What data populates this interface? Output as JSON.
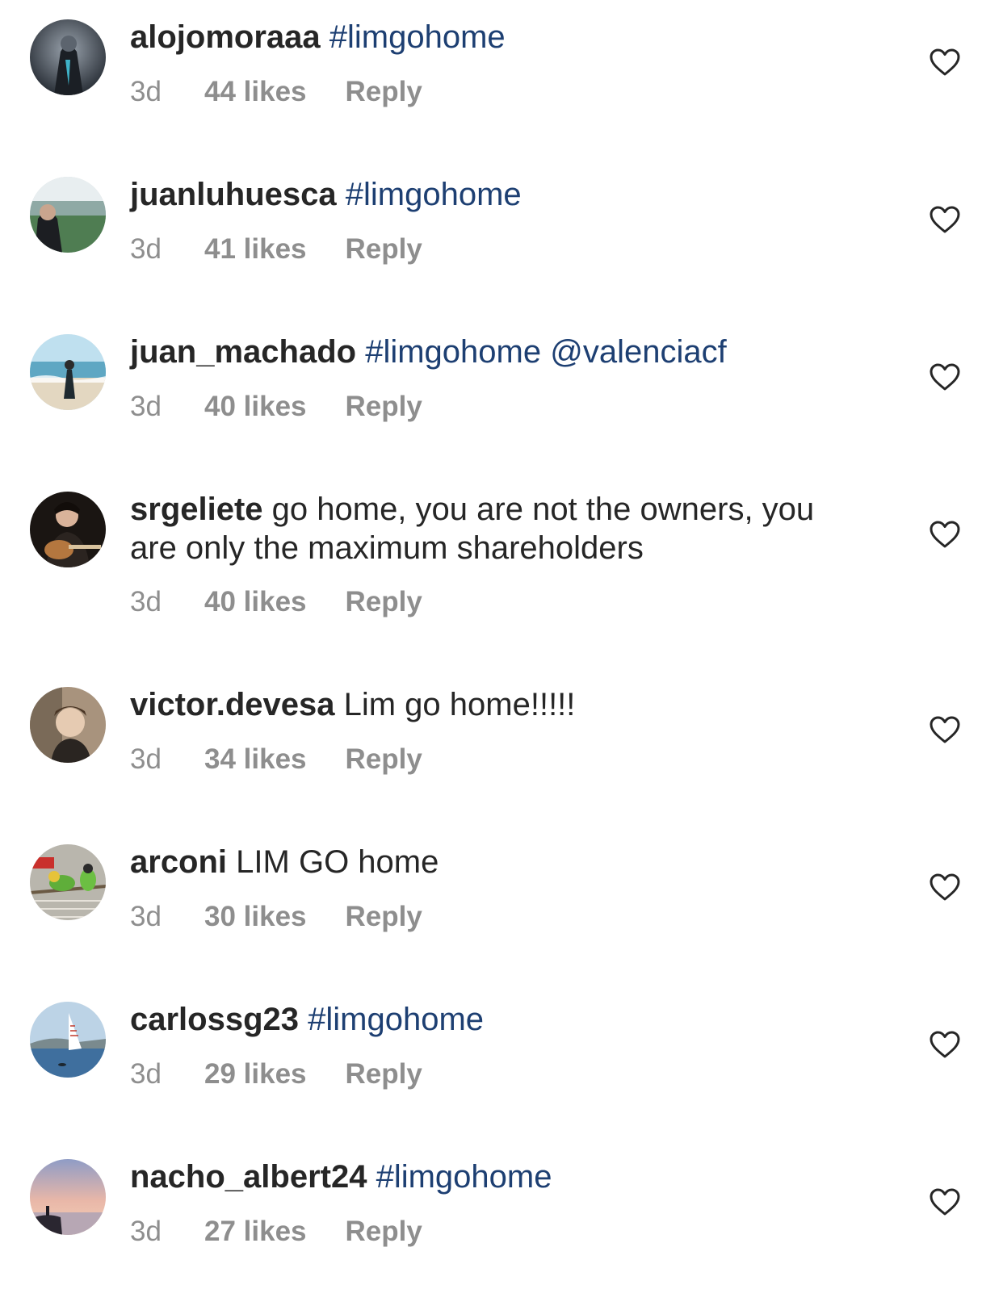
{
  "comments": [
    {
      "username": "alojomoraaa",
      "text_parts": [
        {
          "text": " "
        },
        {
          "tag": "#limgohome"
        }
      ],
      "time": "3d",
      "likes": "44 likes",
      "reply_label": "Reply",
      "avatar": "armored-warrior-avatar"
    },
    {
      "username": "juanluhuesca",
      "text_parts": [
        {
          "text": " "
        },
        {
          "tag": "#limgohome"
        }
      ],
      "time": "3d",
      "likes": "41 likes",
      "reply_label": "Reply",
      "avatar": "stadium-person-avatar"
    },
    {
      "username": "juan_machado",
      "text_parts": [
        {
          "text": " "
        },
        {
          "tag": "#limgohome"
        },
        {
          "text": " "
        },
        {
          "tag": "@valenciacf"
        }
      ],
      "time": "3d",
      "likes": "40 likes",
      "reply_label": "Reply",
      "avatar": "surfer-beach-avatar"
    },
    {
      "username": "srgeliete",
      "text_parts": [
        {
          "text": " go home, you are not the owners, you are only the maximum shareholders"
        }
      ],
      "time": "3d",
      "likes": "40 likes",
      "reply_label": "Reply",
      "avatar": "guitar-player-avatar"
    },
    {
      "username": "victor.devesa",
      "text_parts": [
        {
          "text": " Lim go home!!!!!"
        }
      ],
      "time": "3d",
      "likes": "34 likes",
      "reply_label": "Reply",
      "avatar": "portrait-avatar"
    },
    {
      "username": "arconi",
      "text_parts": [
        {
          "text": " LIM GO home"
        }
      ],
      "time": "3d",
      "likes": "30 likes",
      "reply_label": "Reply",
      "avatar": "parrots-avatar"
    },
    {
      "username": "carlossg23",
      "text_parts": [
        {
          "text": " "
        },
        {
          "tag": "#limgohome"
        }
      ],
      "time": "3d",
      "likes": "29 likes",
      "reply_label": "Reply",
      "avatar": "sailboat-avatar"
    },
    {
      "username": "nacho_albert24",
      "text_parts": [
        {
          "text": " "
        },
        {
          "tag": "#limgohome"
        }
      ],
      "time": "3d",
      "likes": "27 likes",
      "reply_label": "Reply",
      "avatar": "sunset-coast-avatar"
    }
  ],
  "colors": {
    "username": "#262626",
    "text": "#262626",
    "link": "#1d3f72",
    "meta": "#8e8e8e",
    "heart_outline": "#262626"
  },
  "icons": {
    "like": "heart-outline-icon"
  }
}
